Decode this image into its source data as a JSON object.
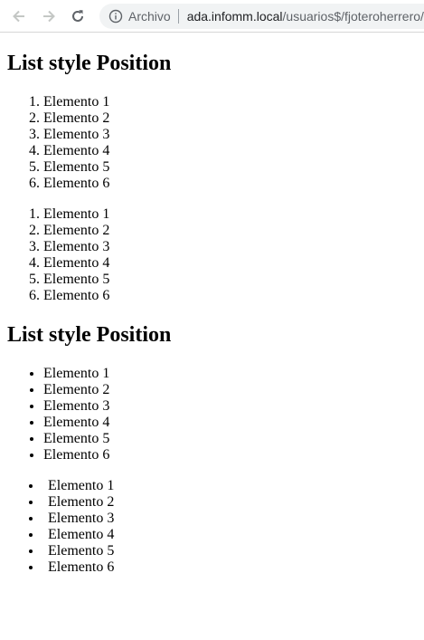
{
  "browser": {
    "secure_chip": "Archivo",
    "url_host": "ada.infomm.local",
    "url_path": "/usuarios$/fjoteroherrero/"
  },
  "page": {
    "heading_1": "List style Position",
    "heading_2": "List style Position",
    "ordered_list_a": [
      "Elemento 1",
      "Elemento 2",
      "Elemento 3",
      "Elemento 4",
      "Elemento 5",
      "Elemento 6"
    ],
    "ordered_list_b": [
      "Elemento 1",
      "Elemento 2",
      "Elemento 3",
      "Elemento 4",
      "Elemento 5",
      "Elemento 6"
    ],
    "unordered_list_a": [
      "Elemento 1",
      "Elemento 2",
      "Elemento 3",
      "Elemento 4",
      "Elemento 5",
      "Elemento 6"
    ],
    "unordered_list_b": [
      "Elemento 1",
      "Elemento 2",
      "Elemento 3",
      "Elemento 4",
      "Elemento 5",
      "Elemento 6"
    ]
  }
}
